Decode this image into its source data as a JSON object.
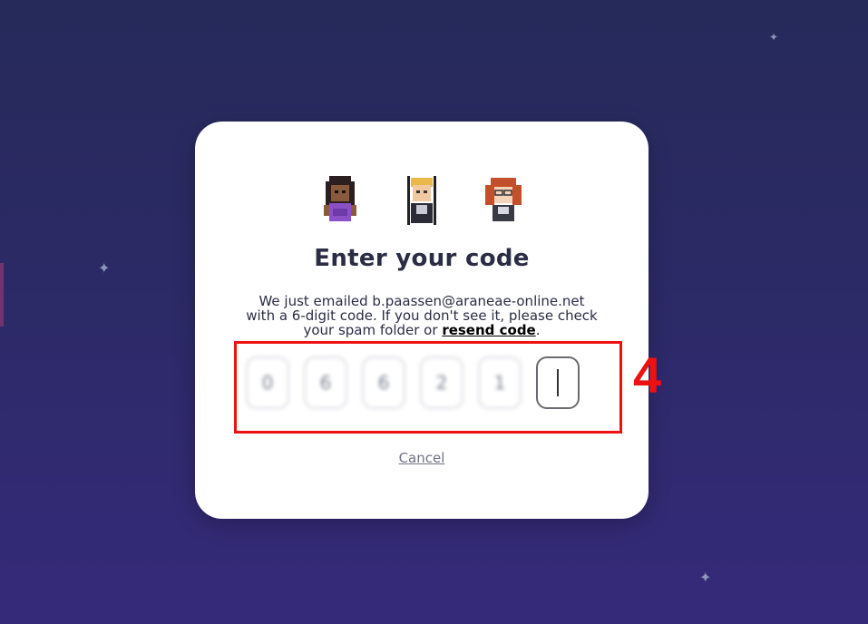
{
  "dialog": {
    "title": "Enter your code",
    "description_line1": "We just emailed b.paassen@araneae-online.net",
    "description_line2": "with a 6-digit code. If you don't see it, please check",
    "description_line3_prefix": "your spam folder or",
    "resend_link": "resend code",
    "description_suffix": ".",
    "cancel_label": "Cancel"
  },
  "code_inputs": {
    "digits": [
      "0",
      "6",
      "6",
      "2",
      "1",
      ""
    ],
    "active_index": 5
  },
  "annotation": {
    "step_number": "4",
    "color": "#ee1111"
  },
  "avatars": [
    "avatar-woman-purple-dress",
    "avatar-blonde-man",
    "avatar-redhead-glasses"
  ],
  "icons": {
    "sparkle": "four-point-star-icon"
  }
}
